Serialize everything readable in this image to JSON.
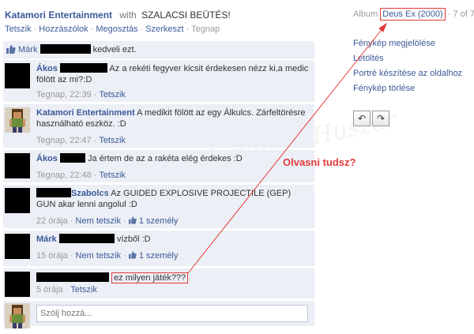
{
  "header": {
    "owner": "Katamori Entertainment",
    "with": "with",
    "caption": "SZALACSI BEÜTÉS!"
  },
  "actions": {
    "like": "Tetszik",
    "comment": "Hozzászólok",
    "share": "Megosztás",
    "edit": "Szerkeszt",
    "time": "Tegnap"
  },
  "likes": {
    "name": "Márk",
    "suffix": "kedveli ezt."
  },
  "comments": [
    {
      "author": "Ákos",
      "text": "Az a rekéti fegyver kicsit érdekesen nézz ki,a medic fölött az mi?:D",
      "time": "Tegnap, 22:39",
      "like": "Tetszik"
    },
    {
      "author": "Katamori Entertainment",
      "text": "A medikit fölött az egy Álkulcs. Zárfeltörésre használható eszköz. :D",
      "time": "Tegnap, 22:47",
      "like": "Tetszik"
    },
    {
      "author": "Ákos",
      "text": "Ja értem de az a rakéta elég érdekes :D",
      "time": "Tegnap, 22:48",
      "like": "Tetszik"
    },
    {
      "author": "Szabolcs",
      "text": "Az GUIDED EXPLOSIVE PROJECTILE (GEP) GUN akar lenni angolul :D",
      "time": "22 órája",
      "like": "Nem tetszik",
      "likes_count": "1 személy"
    },
    {
      "author": "Márk",
      "text": "vízből :D",
      "time": "15 órája",
      "like": "Nem tetszik",
      "likes_count": "1 személy"
    },
    {
      "author": "",
      "text": "ez milyen játék???",
      "time": "5 órája",
      "like": "Tetszik"
    }
  ],
  "write_comment": {
    "placeholder": "Szólj hozzá..."
  },
  "sidebar": {
    "album_label": "Album",
    "album_name": "Deus Ex (2000)",
    "counter": "7 of 7",
    "options": [
      "Fénykép megjelölése",
      "Letöltés",
      "Portré készítése az oldalhoz",
      "Fénykép törlése"
    ]
  },
  "annotation": "Olvasni tudsz?",
  "watermark": "KommentHuszár",
  "colors": {
    "link": "#3b5998",
    "annotation": "#e23b3b",
    "comment_bg": "#eceff5"
  }
}
